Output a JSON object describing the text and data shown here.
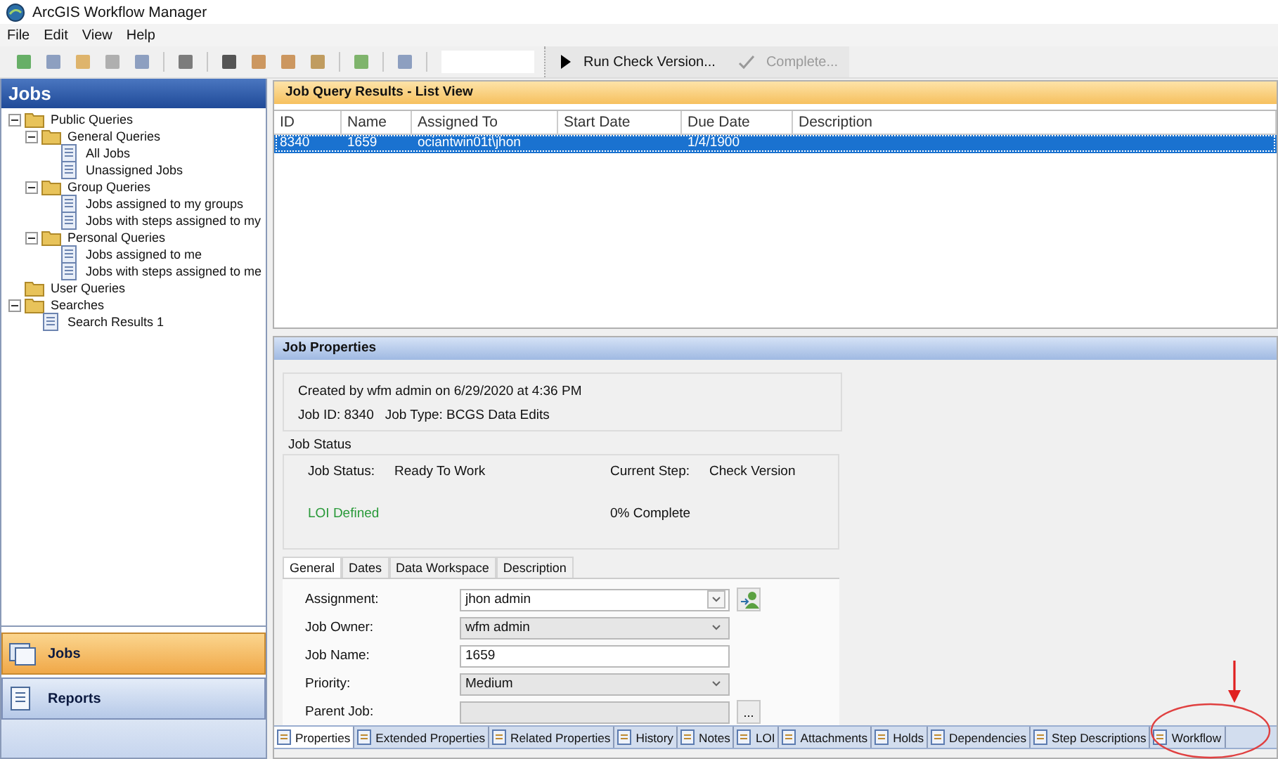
{
  "window": {
    "title": "ArcGIS Workflow Manager"
  },
  "menu": [
    "File",
    "Edit",
    "View",
    "Help"
  ],
  "toolbar": {
    "actions": [
      {
        "label": "Run Check Version...",
        "disabled": false
      },
      {
        "label": "Complete...",
        "disabled": true
      }
    ]
  },
  "sidebar": {
    "title": "Jobs",
    "tree": [
      {
        "label": "Public Queries",
        "kind": "folder",
        "expanded": true,
        "children": [
          {
            "label": "General Queries",
            "kind": "folder",
            "expanded": true,
            "children": [
              {
                "label": "All Jobs",
                "kind": "query"
              },
              {
                "label": "Unassigned Jobs",
                "kind": "query"
              }
            ]
          },
          {
            "label": "Group Queries",
            "kind": "folder",
            "expanded": true,
            "children": [
              {
                "label": "Jobs assigned to my groups",
                "kind": "query"
              },
              {
                "label": "Jobs with steps assigned to my",
                "kind": "query"
              }
            ]
          },
          {
            "label": "Personal Queries",
            "kind": "folder",
            "expanded": true,
            "children": [
              {
                "label": "Jobs assigned to me",
                "kind": "query"
              },
              {
                "label": "Jobs with steps assigned to me",
                "kind": "query"
              }
            ]
          }
        ]
      },
      {
        "label": "User Queries",
        "kind": "folder"
      },
      {
        "label": "Searches",
        "kind": "folder",
        "expanded": true,
        "children": [
          {
            "label": "Search Results 1",
            "kind": "query"
          }
        ]
      }
    ],
    "nav": [
      {
        "label": "Jobs",
        "selected": true
      },
      {
        "label": "Reports",
        "selected": false
      }
    ]
  },
  "results": {
    "title": "Job Query Results - List View",
    "columns": [
      "ID",
      "Name",
      "Assigned To",
      "Start Date",
      "Due Date",
      "Description"
    ],
    "rows": [
      {
        "cells": [
          "8340",
          "1659",
          "ociantwin01t\\jhon",
          "",
          "1/4/1900",
          ""
        ],
        "selected": true
      }
    ]
  },
  "properties": {
    "title": "Job Properties",
    "created": "Created by wfm admin on 6/29/2020 at 4:36 PM",
    "job_id": "Job ID: 8340",
    "job_type": "Job Type: BCGS Data Edits",
    "status": {
      "title": "Job Status",
      "fields": [
        {
          "label": "Job Status:",
          "value": "Ready To Work"
        },
        {
          "label": "Current Step:",
          "value": "Check Version"
        }
      ],
      "loi": "LOI Defined",
      "progress": "0% Complete"
    },
    "tabs": [
      {
        "label": "General",
        "selected": true
      },
      {
        "label": "Dates",
        "selected": false
      },
      {
        "label": "Data Workspace",
        "selected": false
      },
      {
        "label": "Description",
        "selected": false
      }
    ],
    "form": [
      {
        "label": "Assignment:",
        "value": "jhon admin",
        "kind": "dropdown",
        "disabled": false
      },
      {
        "label": "Job Owner:",
        "value": "wfm admin",
        "kind": "dropdown",
        "disabled": true
      },
      {
        "label": "Job Name:",
        "value": "1659",
        "kind": "text",
        "disabled": false
      },
      {
        "label": "Priority:",
        "value": "Medium",
        "kind": "dropdown",
        "disabled": true
      },
      {
        "label": "Parent Job:",
        "kind": "browse",
        "disabled": true,
        "button": "..."
      }
    ],
    "bottom_tabs": [
      {
        "label": "Properties",
        "selected": true
      },
      {
        "label": "Extended Properties",
        "selected": false
      },
      {
        "label": "Related Properties",
        "selected": false
      },
      {
        "label": "History",
        "selected": false
      },
      {
        "label": "Notes",
        "selected": false
      },
      {
        "label": "LOI",
        "selected": false
      },
      {
        "label": "Attachments",
        "selected": false
      },
      {
        "label": "Holds",
        "selected": false
      },
      {
        "label": "Dependencies",
        "selected": false
      },
      {
        "label": "Step Descriptions",
        "selected": false
      },
      {
        "label": "Workflow",
        "selected": false
      }
    ]
  }
}
